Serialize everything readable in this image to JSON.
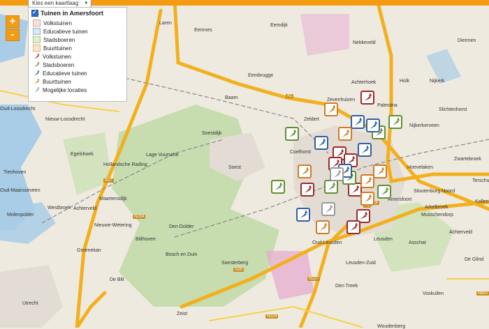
{
  "toolbar": {
    "basemap_select": "Kies een kaartlaag"
  },
  "zoom": {
    "in": "+",
    "out": "-"
  },
  "legend": {
    "title": "Tuinen in Amersfoort",
    "items": [
      {
        "label": "Volkstuinen",
        "kind": "area",
        "color": "#e0a69a"
      },
      {
        "label": "Educatieve tuinen",
        "kind": "area",
        "color": "#8fb7cc"
      },
      {
        "label": "Stadsboeren",
        "kind": "area",
        "color": "#a7c97a"
      },
      {
        "label": "Buurttuinen",
        "kind": "area",
        "color": "#e6b073"
      },
      {
        "label": "Volkstuinen",
        "kind": "marker",
        "color": "#9b2a2a"
      },
      {
        "label": "Stadsboeren",
        "kind": "marker",
        "color": "#5f8f2f"
      },
      {
        "label": "Educatieve tuinen",
        "kind": "marker",
        "color": "#2f5f9f"
      },
      {
        "label": "Buurttuinen",
        "kind": "marker",
        "color": "#d07a23"
      },
      {
        "label": "Mogelijke locaties",
        "kind": "marker",
        "color": "#999999"
      }
    ]
  },
  "places": [
    "Laren",
    "Eemnes",
    "Eemdijk",
    "Nekkeveld",
    "Diermen",
    "Oud-Loosdrecht",
    "Baarn",
    "Eembrugge",
    "Zevenhuizen",
    "Achterhoek",
    "Holk",
    "Nijkerk",
    "Palestina",
    "Slichtenhorst",
    "Nieuw-Loosdrecht",
    "Soestdijk",
    "Zeldert",
    "Nijkerkerveen",
    "Egelshoek",
    "Lage Vuursche",
    "Hollandsche Rading",
    "Coelhorst",
    "Zwartebroek",
    "Tienhoven",
    "Soest",
    "Hoevelaken",
    "Terschuur",
    "Oud-Maarsseveen",
    "Maartensdijk",
    "Stoutenburg Noord",
    "Kallenbroek",
    "Molenpolder",
    "Westbroek",
    "Achterveld",
    "Amersfoort",
    "Musschendorp",
    "Arkelbroek",
    "Nieuwe-Wetering",
    "Den Dolder",
    "Achterveld",
    "Bilthoven",
    "Oud-Leusden",
    "Leusden",
    "Groenekan",
    "Bosch en Duin",
    "Asschat",
    "Soesterberg",
    "Leusden-Zuid",
    "De Glind",
    "De Bilt",
    "Den Treek",
    "Voskuilen",
    "Utrecht",
    "Zeist",
    "Woudenberg"
  ],
  "roads": [
    "A1",
    "A27",
    "N234",
    "A28",
    "N227",
    "N224",
    "N802",
    "A1",
    "A28"
  ],
  "markers": [
    {
      "category": "Volkstuinen",
      "color": "#9b2a2a"
    },
    {
      "category": "Volkstuinen",
      "color": "#9b2a2a"
    },
    {
      "category": "Volkstuinen",
      "color": "#9b2a2a"
    },
    {
      "category": "Volkstuinen",
      "color": "#9b2a2a"
    },
    {
      "category": "Volkstuinen",
      "color": "#9b2a2a"
    },
    {
      "category": "Volkstuinen",
      "color": "#9b2a2a"
    },
    {
      "category": "Volkstuinen",
      "color": "#9b2a2a"
    },
    {
      "category": "Volkstuinen",
      "color": "#9b2a2a"
    },
    {
      "category": "Stadsboeren",
      "color": "#5f8f2f"
    },
    {
      "category": "Stadsboeren",
      "color": "#5f8f2f"
    },
    {
      "category": "Stadsboeren",
      "color": "#5f8f2f"
    },
    {
      "category": "Stadsboeren",
      "color": "#5f8f2f"
    },
    {
      "category": "Stadsboeren",
      "color": "#5f8f2f"
    },
    {
      "category": "Stadsboeren",
      "color": "#5f8f2f"
    },
    {
      "category": "Stadsboeren",
      "color": "#5f8f2f"
    },
    {
      "category": "Educatieve tuinen",
      "color": "#2f5f9f"
    },
    {
      "category": "Educatieve tuinen",
      "color": "#2f5f9f"
    },
    {
      "category": "Educatieve tuinen",
      "color": "#2f5f9f"
    },
    {
      "category": "Educatieve tuinen",
      "color": "#2f5f9f"
    },
    {
      "category": "Educatieve tuinen",
      "color": "#2f5f9f"
    },
    {
      "category": "Educatieve tuinen",
      "color": "#2f5f9f"
    },
    {
      "category": "Buurttuinen",
      "color": "#d07a23"
    },
    {
      "category": "Buurttuinen",
      "color": "#d07a23"
    },
    {
      "category": "Buurttuinen",
      "color": "#d07a23"
    },
    {
      "category": "Buurttuinen",
      "color": "#d07a23"
    },
    {
      "category": "Buurttuinen",
      "color": "#d07a23"
    },
    {
      "category": "Buurttuinen",
      "color": "#d07a23"
    },
    {
      "category": "Buurttuinen",
      "color": "#d07a23"
    },
    {
      "category": "Mogelijke locaties",
      "color": "#999999"
    },
    {
      "category": "Mogelijke locaties",
      "color": "#999999"
    }
  ]
}
